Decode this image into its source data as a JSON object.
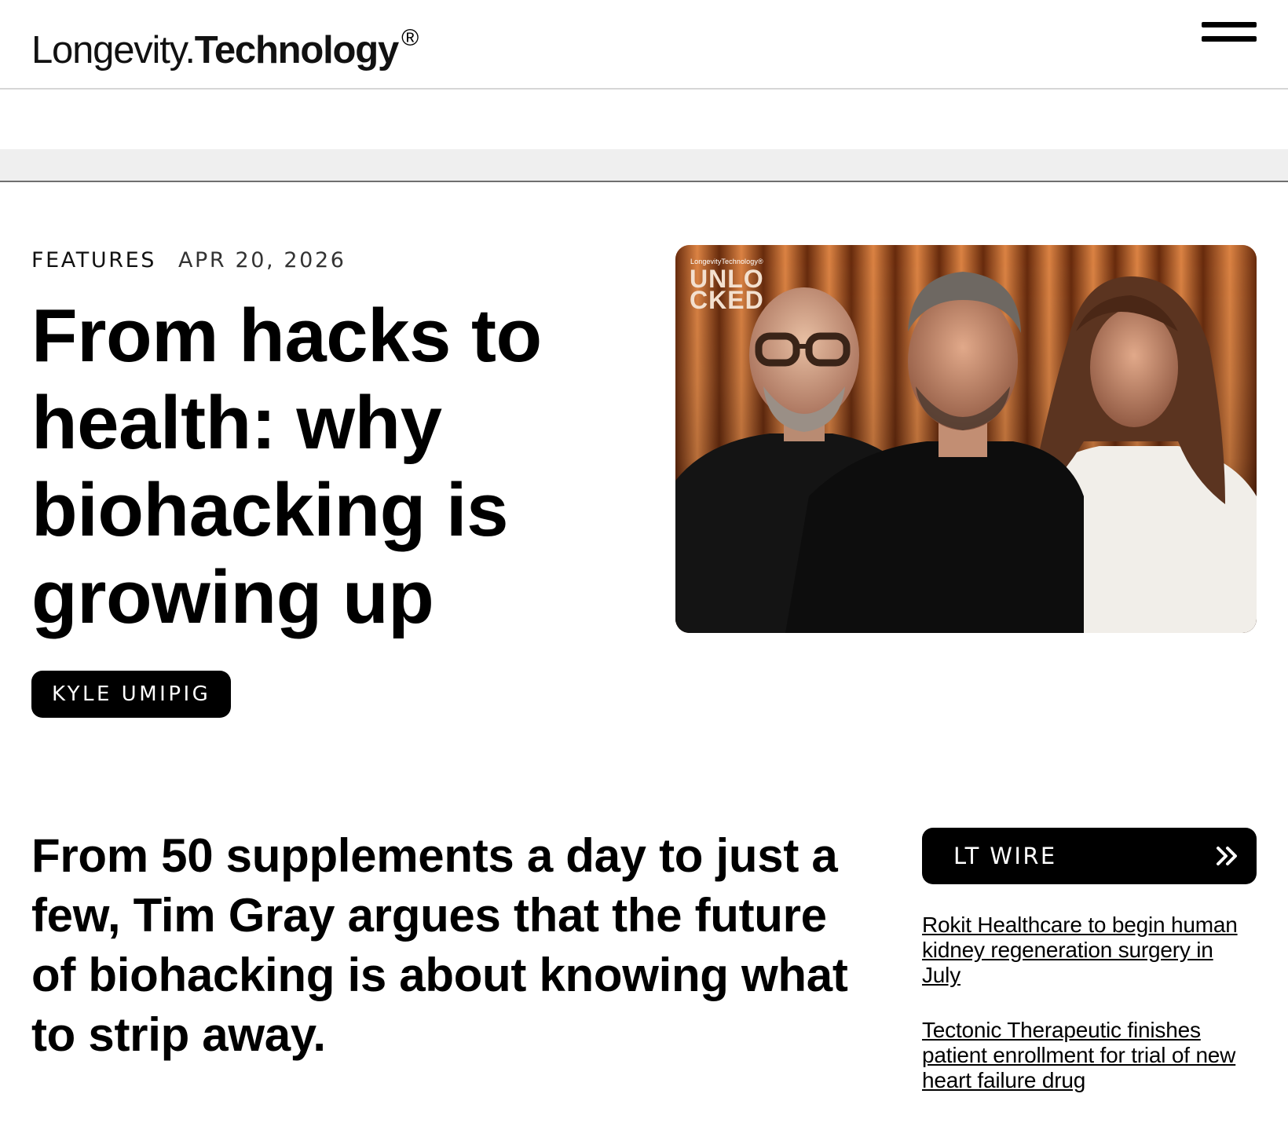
{
  "header": {
    "logo_light": "Longevity.",
    "logo_bold": "Technology",
    "logo_mark": "®",
    "menu_icon": "hamburger-menu-icon"
  },
  "article": {
    "category": "FEATURES",
    "date": "APR 20, 2026",
    "headline": "From hacks to health: why biohacking is growing up",
    "author": "KYLE UMIPIG",
    "standfirst": "From 50 supplements a day to just a few, Tim Gray argues that the future of biohacking is about knowing what to strip away."
  },
  "hero_image": {
    "brand": "LongevityTechnology®",
    "title": "UNLOCKED"
  },
  "wire": {
    "title": "LT WIRE",
    "icon": "double-chevron-right-icon",
    "items": [
      "Rokit Healthcare to begin human kidney regeneration surgery in July",
      "Tectonic Therapeutic finishes patient enrollment for trial of new heart failure drug"
    ]
  },
  "colors": {
    "background": "#ffffff",
    "text": "#000000",
    "band": "#efefef",
    "button": "#000000",
    "hero_accent": "#d2773a"
  }
}
